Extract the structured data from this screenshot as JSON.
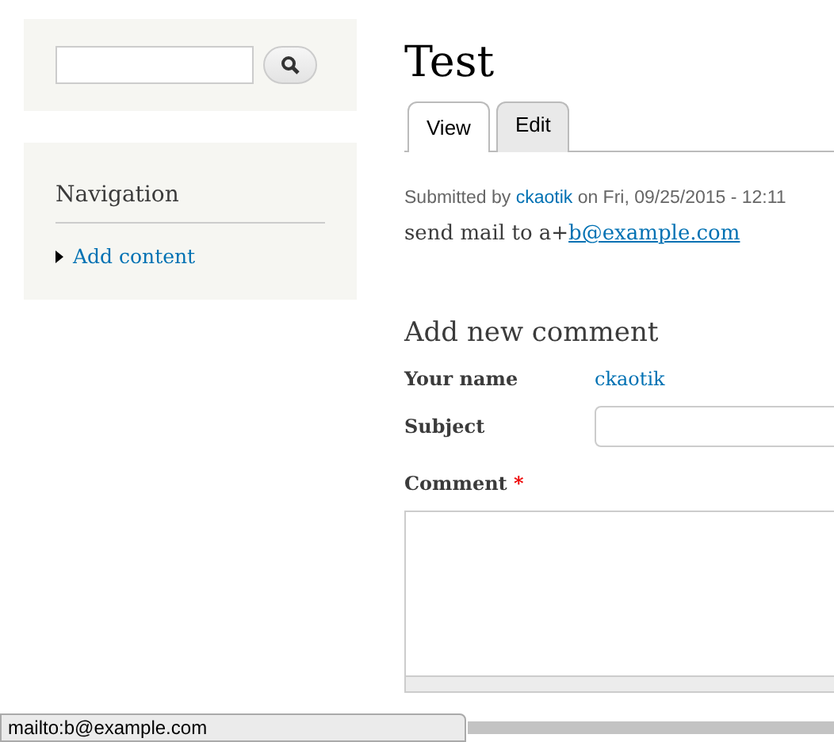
{
  "sidebar": {
    "navigation": {
      "title": "Navigation",
      "items": [
        {
          "label": "Add content"
        }
      ]
    }
  },
  "page": {
    "title": "Test",
    "tabs": [
      {
        "label": "View",
        "selected": true
      },
      {
        "label": "Edit",
        "selected": false
      }
    ],
    "submitted": {
      "prefix": "Submitted by",
      "author": "ckaotik",
      "date": "on Fri, 09/25/2015 - 12:11"
    },
    "body": {
      "text": "send mail to a+",
      "link": "b@example.com"
    }
  },
  "comment_form": {
    "title": "Add new comment",
    "your_name_label": "Your name",
    "your_name": "ckaotik",
    "subject_label": "Subject",
    "comment_label": "Comment",
    "required_mark": "*"
  },
  "status_bar": {
    "text": "mailto:b@example.com"
  }
}
